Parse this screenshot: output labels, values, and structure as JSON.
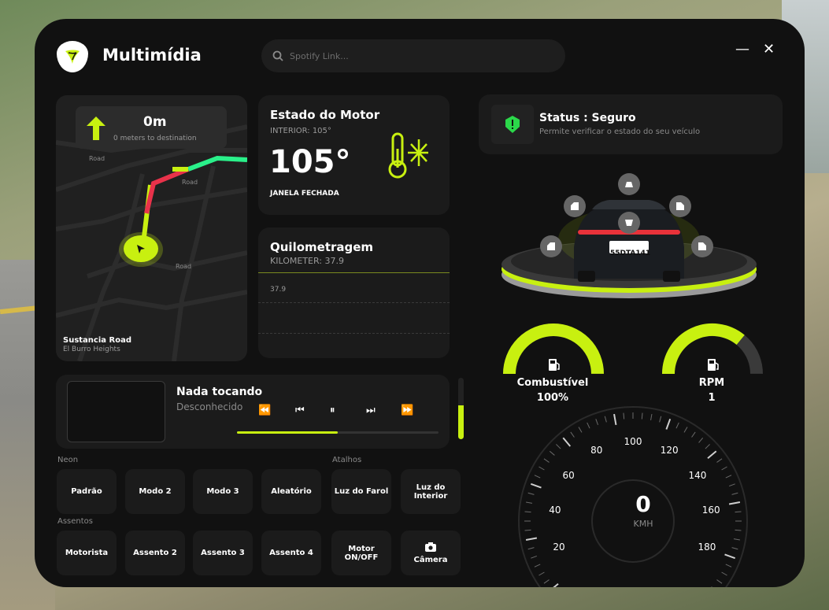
{
  "app": {
    "title": "Multimídia",
    "logo_icon": "logo-icon"
  },
  "search": {
    "placeholder": "Spotify Link..."
  },
  "window": {
    "minimize_label": "—",
    "close_label": "✕"
  },
  "map": {
    "distance": "0m",
    "distance_sub": "0 meters to destination",
    "road_labels": [
      "Road",
      "Road",
      "Road"
    ],
    "street": "Sustancia Road",
    "area": "El Burro Heights"
  },
  "motor": {
    "title": "Estado do Motor",
    "interior": "INTERIOR: 105°",
    "temperature": "105°",
    "window": "JANELA FECHADA"
  },
  "km": {
    "title": "Quilometragem",
    "subtitle": "KILOMETER: 37.9",
    "value": "37.9"
  },
  "player": {
    "title": "Nada tocando",
    "artist": "Desconhecido",
    "progress_fraction": 0.5,
    "volume_fraction": 0.55,
    "controls": [
      "⏪",
      "⏮",
      "⏸",
      "⏭",
      "⏩"
    ]
  },
  "neon": {
    "label": "Neon",
    "buttons": [
      "Padrão",
      "Modo 2",
      "Modo 3",
      "Aleatório"
    ]
  },
  "atalhos": {
    "label": "Atalhos",
    "buttons": [
      "Luz do Farol",
      "Luz do Interior",
      "Motor ON/OFF",
      "Câmera"
    ]
  },
  "assentos": {
    "label": "Assentos",
    "buttons": [
      "Motorista",
      "Assento 2",
      "Assento 3",
      "Assento 4"
    ]
  },
  "status": {
    "title": "Status : Seguro",
    "subtitle": "Permite verificar o estado do seu veículo"
  },
  "car": {
    "plate": "55DTA141"
  },
  "fuel": {
    "label": "Combustível",
    "value": "100%",
    "fraction": 1.0
  },
  "rpm": {
    "label": "RPM",
    "value": "1",
    "fraction": 0.72
  },
  "speedometer": {
    "speed": "0",
    "unit": "KMH",
    "ticks": [
      "20",
      "40",
      "60",
      "80",
      "100",
      "120",
      "140",
      "160",
      "180"
    ]
  },
  "colors": {
    "accent": "#c8f010",
    "panel": "#111111",
    "card": "#1b1b1b",
    "route_red": "#e8324a",
    "route_green": "#2af08a"
  }
}
